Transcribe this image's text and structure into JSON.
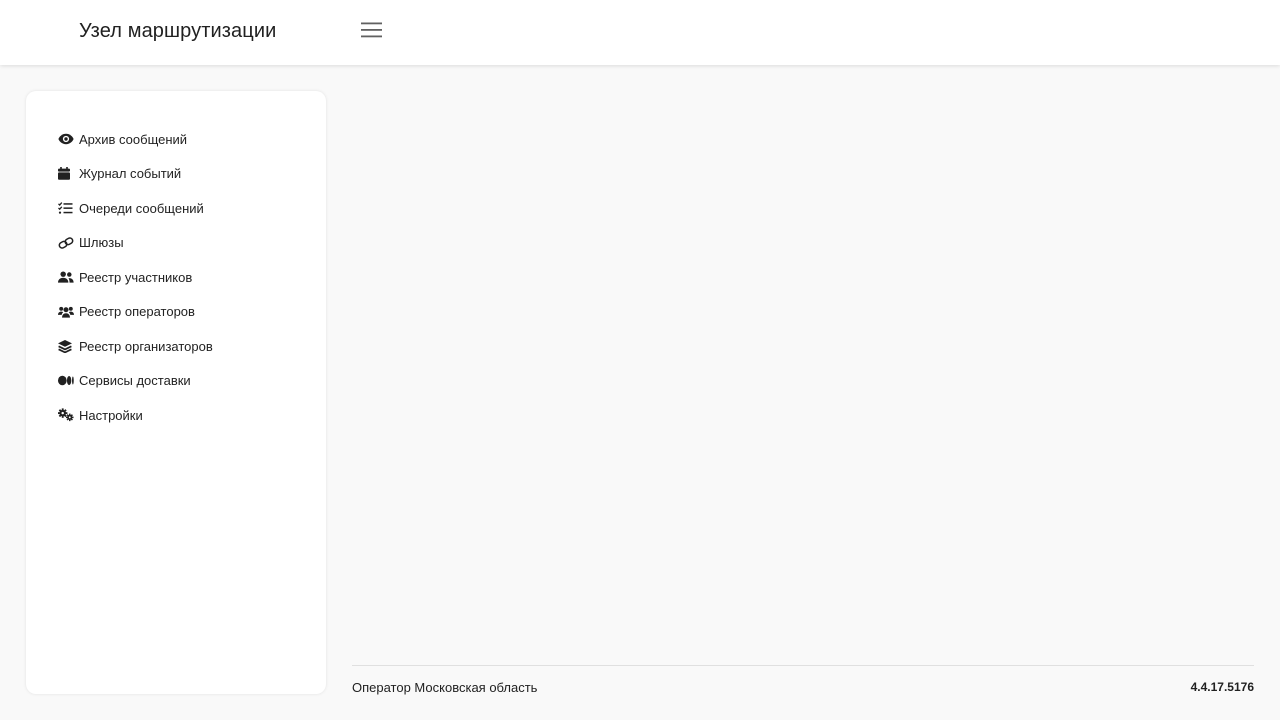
{
  "header": {
    "title": "Узел маршрутизации",
    "menu_icon": "hamburger-menu-icon"
  },
  "sidebar": {
    "items": [
      {
        "label": "Архив сообщений",
        "icon": "eye-icon"
      },
      {
        "label": "Журнал событий",
        "icon": "calendar-icon"
      },
      {
        "label": "Очереди сообщений",
        "icon": "task-list-icon"
      },
      {
        "label": "Шлюзы",
        "icon": "link-icon"
      },
      {
        "label": "Реестр участников",
        "icon": "user-group-icon"
      },
      {
        "label": "Реестр операторов",
        "icon": "users-three-icon"
      },
      {
        "label": "Реестр организаторов",
        "icon": "layers-icon"
      },
      {
        "label": "Сервисы доставки",
        "icon": "medium-logo-icon"
      },
      {
        "label": "Настройки",
        "icon": "gears-icon"
      }
    ]
  },
  "footer": {
    "operator": "Оператор Московская область",
    "version": "4.4.17.5176"
  },
  "colors": {
    "background": "#f9f9f9",
    "surface": "#ffffff",
    "text": "#212121",
    "divider": "#e0e0e0"
  }
}
